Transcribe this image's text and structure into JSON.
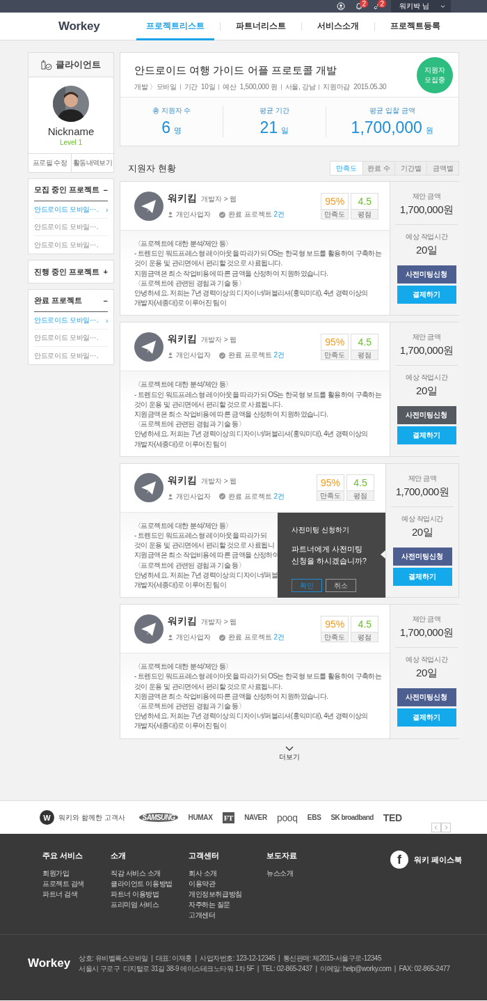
{
  "topbar": {
    "notifications": "2",
    "links": "2",
    "user": "워키박 님"
  },
  "nav": {
    "logo": "Workey",
    "items": [
      {
        "label": "프로젝트리스트",
        "selected": true
      },
      {
        "label": "파트너리스트",
        "selected": false
      },
      {
        "label": "서비스소개",
        "selected": false
      },
      {
        "label": "프로젝트등록",
        "selected": false
      }
    ]
  },
  "client": {
    "title": "클라이언트",
    "nickname": "Nickname",
    "level": "Level 1",
    "buttons": [
      "프로필 수정",
      "활동내역보기"
    ]
  },
  "sidebar": [
    {
      "title": "모집 중인 프로젝트",
      "toggle": "−",
      "expanded": true,
      "items": [
        {
          "label": "안드로이드 모바일⋯.",
          "selected": true,
          "arrow": "›"
        },
        {
          "label": "안드로이드 모바일⋯.",
          "selected": false
        },
        {
          "label": "안드로이드 모바일⋯.",
          "selected": false
        }
      ]
    },
    {
      "title": "진행 중인 프로젝트",
      "toggle": "+",
      "expanded": false
    },
    {
      "title": "완료 프로젝트",
      "toggle": "−",
      "expanded": true,
      "items": [
        {
          "label": "안드로이드 모바일⋯.",
          "selected": true,
          "arrow": "›"
        },
        {
          "label": "안드로이드 모바일⋯.",
          "selected": false
        },
        {
          "label": "안드로이드 모바일⋯.",
          "selected": false
        }
      ]
    }
  ],
  "project": {
    "title": "안드로이드 여행 가이드 어플 프로토콜 개발",
    "meta": [
      "개발 〉모바일",
      "기간  10일",
      "예산  1,500,000 원",
      "서울, 강남",
      "지원마감  2015.05.30"
    ],
    "status": "지원자 모집중",
    "stats": [
      {
        "label": "총 지원자 수",
        "value": "6",
        "unit": "명"
      },
      {
        "label": "평균 기간",
        "value": "21",
        "unit": "일"
      },
      {
        "label": "평균 입찰 금액",
        "value": "1,700,000",
        "unit": "원"
      }
    ]
  },
  "applicants_title": "지원자 현황",
  "sort_tabs": [
    {
      "label": "만족도",
      "selected": true
    },
    {
      "label": "완료 수",
      "selected": false
    },
    {
      "label": "기간별",
      "selected": false
    },
    {
      "label": "금액별",
      "selected": false
    }
  ],
  "applicants": [
    {
      "name": "워키킴",
      "category": "개발자 > 웹",
      "type": "개인사업자",
      "completed_label": "완료 프로젝트",
      "completed_count": "2건",
      "satisfaction": "95%",
      "satisfaction_label": "만족도",
      "rating": "4.5",
      "rating_label": "평점",
      "lines": [
        "〈프로젝트에 대한 분석/제안 등〉",
        "- 트렌드인 워드프레스형 레이아웃을 따라가되 OS는 한국형 보드를 활용하여 구축하는",
        "것이 운용 및 관리면에서 편리할 것으로 사료됩니다.",
        "지원금액은 최소 작업비용에 따른 금액을 산정하여 지원하였습니다.",
        "〈프로젝트에 관련된 경험과 기술 등〉",
        "안녕하세요. 저희는 7년 경력이상의 디자이너/퍼블리셔(홍익미대), 4년 경력이상의",
        "개발자(세종대)로 이루어진 팀이"
      ],
      "price_label": "제안 금액",
      "price": "1,700,000원",
      "time_label": "예상 작업시간",
      "time": "20일",
      "meeting_button": "사전미팅신청",
      "meeting_active": false,
      "pay_button": "결제하기"
    },
    {
      "name": "워키킴",
      "category": "개발자 > 웹",
      "type": "개인사업자",
      "completed_label": "완료 프로젝트",
      "completed_count": "2건",
      "satisfaction": "95%",
      "satisfaction_label": "만족도",
      "rating": "4.5",
      "rating_label": "평점",
      "lines": [
        "〈프로젝트에 대한 분석/제안 등〉",
        "- 트렌드인 워드프레스형 레이아웃을 따라가되 OS는 한국형 보드를 활용하여 구축하는",
        "것이 운용 및 관리면에서 편리할 것으로 사료됩니다.",
        "지원금액은 최소 작업비용에 따른 금액을 산정하여 지원하였습니다.",
        "〈프로젝트에 관련된 경험과 기술 등〉",
        "안녕하세요. 저희는 7년 경력이상의 디자이너/퍼블리셔(홍익미대), 4년 경력이상의",
        "개발자(세종대)로 이루어진 팀이"
      ],
      "price_label": "제안 금액",
      "price": "1,700,000원",
      "time_label": "예상 작업시간",
      "time": "20일",
      "meeting_button": "사전미팅신청",
      "meeting_active": true,
      "pay_button": "결제하기"
    },
    {
      "name": "워키킴",
      "category": "개발자 > 웹",
      "type": "개인사업자",
      "completed_label": "완료 프로젝트",
      "completed_count": "2건",
      "satisfaction": "95%",
      "satisfaction_label": "만족도",
      "rating": "4.5",
      "rating_label": "평점",
      "lines": [
        "〈프로젝트에 대한 분석/제안 등〉",
        "- 트렌드인 워드프레스형 레이아웃을 따라가되",
        "것이 운용 및 관리면에서 편리할 것으로 사료됩니",
        "지원금액은 최소 작업비용에 따른 금액을 산정하여",
        "〈프로젝트에 관련된 경험과 기술 등〉",
        "안녕하세요. 저희는 7년 경력이상의 디자이너/퍼블",
        "개발자(세종대)로 이루어진 팀이"
      ],
      "price_label": "제안 금액",
      "price": "1,700,000원",
      "time_label": "예상 작업시간",
      "time": "20일",
      "meeting_button": "사전미팅신청",
      "meeting_active": false,
      "pay_button": "결제하기",
      "popup": {
        "title": "사전미팅 신청하기",
        "message": "파트너에게 사전미팅 신청을 하시겠습니까?",
        "confirm": "확인",
        "cancel": "취소"
      }
    },
    {
      "name": "워키킴",
      "category": "개발자 > 웹",
      "type": "개인사업자",
      "completed_label": "완료 프로젝트",
      "completed_count": "2건",
      "satisfaction": "95%",
      "satisfaction_label": "만족도",
      "rating": "4.5",
      "rating_label": "평점",
      "lines": [
        "〈프로젝트에 대한 분석/제안 등〉",
        "- 트렌드인 워드프레스형 레이아웃을 따라가되 OS는 한국형 보드를 활용하여 구축하는",
        "것이 운용 및 관리면에서 편리할 것으로 사료됩니다.",
        "지원금액은 최소 작업비용에 따른 금액을 산정하여 지원하였습니다.",
        "〈프로젝트에 관련된 경험과 기술 등〉",
        "안녕하세요. 저희는 7년 경력이상의 디자이너/퍼블리셔(홍익미대), 4년 경력이상의",
        "개발자(세종대)로 이루어진 팀이"
      ],
      "price_label": "제안 금액",
      "price": "1,700,000원",
      "time_label": "예상 작업시간",
      "time": "20일",
      "meeting_button": "사전미팅신청",
      "meeting_active": false,
      "pay_button": "결제하기"
    }
  ],
  "more": "더보기",
  "clients_strip": {
    "mark": "W",
    "title": "워키와 함께한 고객사",
    "logos": [
      "SAMSUNG",
      "HUMAX",
      "FT",
      "NAVER",
      "pooq",
      "EBS",
      "SK broadband",
      "TED"
    ]
  },
  "footer": {
    "columns": [
      {
        "title": "주요 서비스",
        "links": [
          "회원가입",
          "프로젝트 검색",
          "파트너 검색"
        ]
      },
      {
        "title": "소개",
        "links": [
          "직감 서비스 소개",
          "클라이언트 이용방법",
          "파트너 이용방법",
          "프리미엄 서비스"
        ]
      },
      {
        "title": "고객센터",
        "links": [
          "회사 소개",
          "이용약관",
          "개인정보취급방침",
          "자주하는 질문",
          "고개센터"
        ]
      },
      {
        "title": "보도자료",
        "links": [
          "뉴스소개"
        ]
      }
    ],
    "facebook": {
      "icon": "f",
      "label": "워키 페이스북"
    },
    "logo": "Workey",
    "info": [
      "상호: 유비벨록스모바일  |  대표: 이재홍  |  사업자번호: 123-12-12345  |  통신판매: 제2015-서울구로-12345",
      "서울시 구로구  디지털로 31길 38-9 에이스테크노타워 1차 5F  |  TEL: 02-865-2437  |  이메일: help@worky.com  |  FAX: 02-865-2477"
    ]
  }
}
